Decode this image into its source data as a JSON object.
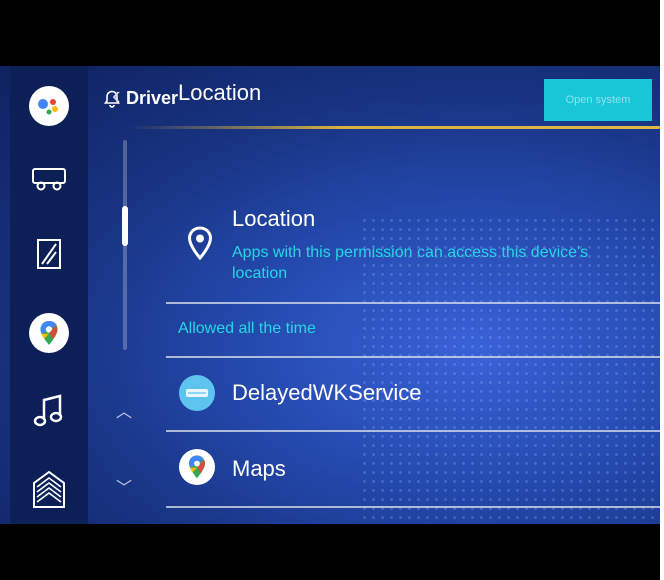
{
  "topbar": {
    "profile": "Driver"
  },
  "header": {
    "title": "Location",
    "top_button": "Open system"
  },
  "permission": {
    "heading": "Location",
    "description": "Apps with this permission can access this device's location"
  },
  "section": {
    "title": "Allowed all the time"
  },
  "apps": [
    {
      "label": "DelayedWKService",
      "icon": "service-icon"
    },
    {
      "label": "Maps",
      "icon": "maps-icon"
    }
  ],
  "rail": [
    "assistant-icon",
    "vehicle-icon",
    "window-icon",
    "maps-icon",
    "music-icon",
    "home-icon"
  ],
  "colors": {
    "accent": "#27d6e4",
    "rail": "#0c1f57",
    "button": "#19c6d8",
    "gold": "#d8b040"
  }
}
